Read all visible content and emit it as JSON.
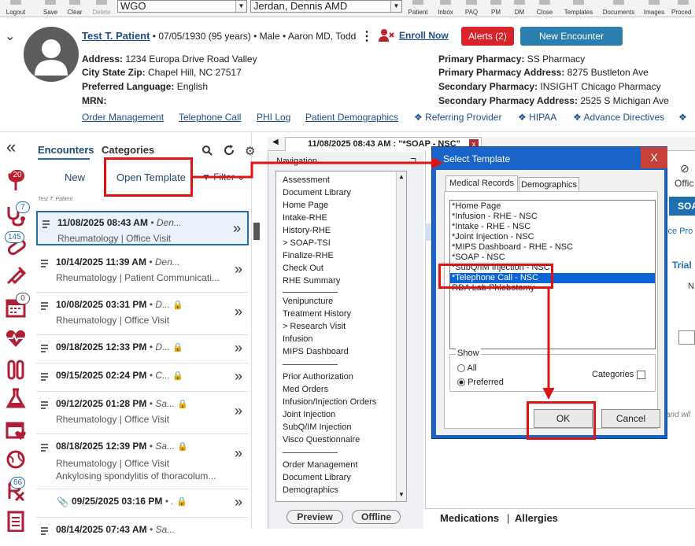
{
  "toolbar": {
    "logout": "Logout",
    "save": "Save",
    "clear": "Clear",
    "delete": "Delete",
    "combo_wgo": "WGO",
    "combo_provider": "Jerdan, Dennis AMD",
    "patient": "Patient",
    "inbox": "Inbox",
    "paq": "PAQ",
    "pm": "PM",
    "dm": "DM",
    "close": "Close",
    "templates": "Templates",
    "documents": "Documents",
    "images": "Images",
    "procedures": "Proced"
  },
  "patient": {
    "name": "Test T. Patient",
    "summary": " • 07/05/1930 (95 years) • Male • Aaron MD, Todd",
    "enroll": "Enroll Now",
    "alerts": "Alerts (2)",
    "new_encounter": "New Encounter",
    "address_label": "Address:",
    "address": "1234 Europa Drive Road Valley",
    "city_label": "City State Zip:",
    "city": "Chapel Hill, NC 27517",
    "language_label": "Preferred Language:",
    "language": "English",
    "mrn_label": "MRN:",
    "primary_pharmacy_label": "Primary Pharmacy:",
    "primary_pharmacy": "SS Pharmacy",
    "primary_pharmacy_address_label": "Primary Pharmacy Address:",
    "primary_pharmacy_address": "8275 Bustleton Ave",
    "secondary_pharmacy_label": "Secondary Pharmacy:",
    "secondary_pharmacy": "INSIGHT Chicago Pharmacy",
    "secondary_pharmacy_address_label": "Secondary Pharmacy Address:",
    "secondary_pharmacy_address": "2525 S Michigan Ave"
  },
  "links": [
    "Order Management",
    "Telephone Call",
    "PHI Log",
    "Patient Demographics",
    "Referring Provider",
    "HIPAA",
    "Advance Directives"
  ],
  "sidebar_badges": {
    "b1": "20",
    "b2": "7",
    "b3": "145",
    "b4": "0",
    "b5": "66"
  },
  "encounters_panel": {
    "tab_encounters": "Encounters",
    "tab_categories": "Categories",
    "new": "New",
    "open_template": "Open Template",
    "filter": "Filter",
    "patient_caption": "Test T. Patient",
    "items": [
      {
        "date": "11/08/2025 08:43 AM",
        "who": "Den...",
        "line2": "Rheumatology | Office Visit"
      },
      {
        "date": "10/14/2025 11:39 AM",
        "who": "Den...",
        "line2": "Rheumatology | Patient Communicati..."
      },
      {
        "date": "10/08/2025 03:31 PM",
        "who": "D...",
        "line2": "Rheumatology | Office Visit"
      },
      {
        "date": "09/18/2025 12:33 PM",
        "who": "D...",
        "line2": ""
      },
      {
        "date": "09/15/2025 02:24 PM",
        "who": "C...",
        "line2": ""
      },
      {
        "date": "09/12/2025 01:28 PM",
        "who": "Sa...",
        "line2": "Rheumatology | Office Visit"
      },
      {
        "date": "08/18/2025 12:39 PM",
        "who": "Sa...",
        "line2": "Rheumatology | Office Visit",
        "line3": "Ankylosing spondylitis of thoracolum..."
      },
      {
        "date": "09/25/2025 03:16 PM",
        "who": ".",
        "line2": ""
      },
      {
        "date": "08/14/2025 07:43 AM",
        "who": "Sa...",
        "line2": ""
      }
    ]
  },
  "document_tab": "11/08/2025 08:43 AM : \"*SOAP - NSC\"",
  "navigation": {
    "title": "Navigation",
    "items": [
      "Assessment",
      "Document Library",
      "Home Page",
      "Intake-RHE",
      "History-RHE",
      "> SOAP-TSI",
      "Finalize-RHE",
      "Check Out",
      "RHE Summary",
      "Venipuncture",
      "Treatment History",
      "> Research Visit",
      "Infusion",
      "MIPS Dashboard",
      "Prior Authorization",
      "Med Orders",
      "Infusion/Injection Orders",
      "Joint Injection",
      "SubQ/IM Injection",
      "Visco Questionnaire",
      "Order Management",
      "Document Library",
      "Demographics"
    ],
    "preview": "Preview",
    "offline": "Offline"
  },
  "dialog": {
    "title": "Select Template",
    "close": "X",
    "tab1": "Medical Records",
    "tab2": "Demographics",
    "items": [
      "*Home Page",
      "*Infusion - RHE - NSC",
      "*Intake - RHE - NSC",
      "*Joint Injection - NSC",
      "*MIPS Dashboard - RHE - NSC",
      "*SOAP - NSC",
      "*SubQ/IM Injection - NSC",
      "*Telephone Call - NSC",
      "RDA Lab Phlebotomy"
    ],
    "selected_index": 7,
    "show_label": "Show",
    "all": "All",
    "preferred": "Preferred",
    "categories": "Categories",
    "ok": "OK",
    "cancel": "Cancel"
  },
  "right_fragments": {
    "offic": "Offic",
    "soa": "SOA",
    "ice_pro": "ice Pro",
    "trial": "Trial",
    "n": "N",
    "and_wil": "and wil"
  },
  "bottom": {
    "medications": "Medications",
    "sep": "|",
    "allergies": "Allergies"
  },
  "colors": {
    "accent": "#1f6fb2",
    "alert": "#d8232a",
    "new_encounter": "#2a7faf",
    "highlight": "#e01313",
    "selection": "#0a64d8"
  }
}
